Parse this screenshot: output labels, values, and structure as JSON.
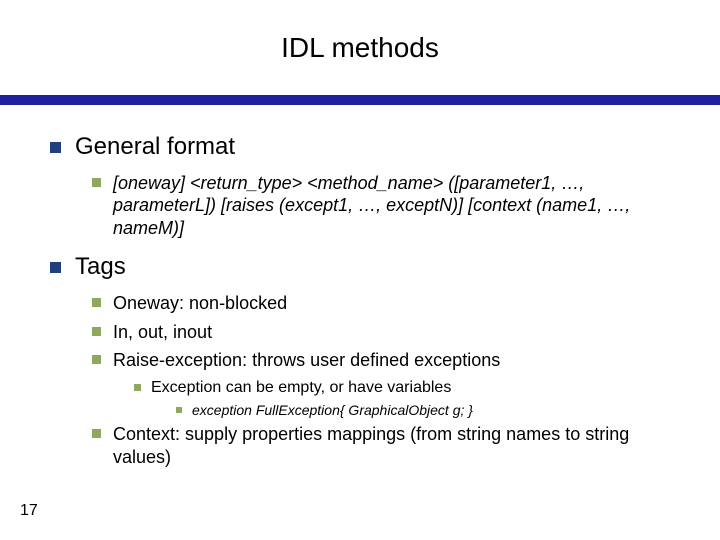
{
  "slide": {
    "title": "IDL methods",
    "pageNumber": "17",
    "sections": [
      {
        "heading": "General format",
        "items": [
          {
            "text": "[oneway] <return_type> <method_name> ([parameter1, …, parameterL]) [raises (except1, …, exceptN)] [context (name1, …, nameM)]",
            "italic": true
          }
        ]
      },
      {
        "heading": "Tags",
        "items": [
          {
            "text": "Oneway: non-blocked"
          },
          {
            "text": "In, out, inout"
          },
          {
            "text": "Raise-exception: throws user defined exceptions",
            "sub": [
              {
                "text": "Exception can be empty, or have variables",
                "sub": [
                  {
                    "text": "exception FullException{ GraphicalObject g; }"
                  }
                ]
              }
            ]
          },
          {
            "text": "Context: supply properties mappings (from string names to string values)"
          }
        ]
      }
    ]
  }
}
